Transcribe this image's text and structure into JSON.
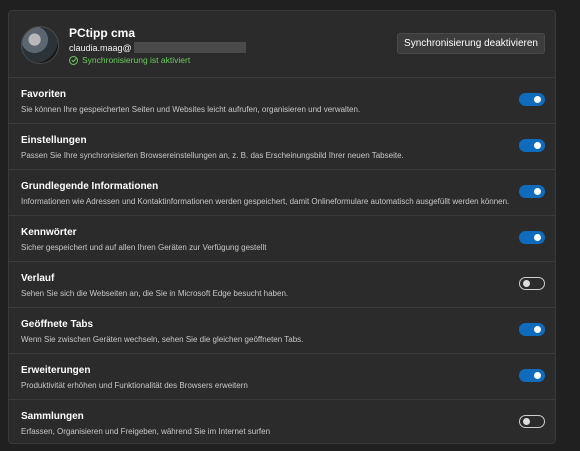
{
  "profile": {
    "name": "PCtipp cma",
    "email": "claudia.maag@",
    "sync_status": "Synchronisierung ist aktiviert"
  },
  "actions": {
    "disable_sync": "Synchronisierung deaktivieren"
  },
  "colors": {
    "accent": "#0f6cbd",
    "success": "#6ccb5f",
    "background": "#202020",
    "card": "#2b2b2b"
  },
  "rows": [
    {
      "title": "Favoriten",
      "desc": "Sie können Ihre gespeicherten Seiten und Websites leicht aufrufen, organisieren und verwalten.",
      "enabled": true
    },
    {
      "title": "Einstellungen",
      "desc": "Passen Sie Ihre synchronisierten Browsereinstellungen an, z. B. das Erscheinungsbild Ihrer neuen Tabseite.",
      "enabled": true
    },
    {
      "title": "Grundlegende Informationen",
      "desc": "Informationen wie Adressen und Kontaktinformationen werden gespeichert, damit Onlineformulare automatisch ausgefüllt werden können.",
      "enabled": true
    },
    {
      "title": "Kennwörter",
      "desc": "Sicher gespeichert und auf allen Ihren Geräten zur Verfügung gestellt",
      "enabled": true
    },
    {
      "title": "Verlauf",
      "desc": "Sehen Sie sich die Webseiten an, die Sie in Microsoft Edge besucht haben.",
      "enabled": false
    },
    {
      "title": "Geöffnete Tabs",
      "desc": "Wenn Sie zwischen Geräten wechseln, sehen Sie die gleichen geöffneten Tabs.",
      "enabled": true
    },
    {
      "title": "Erweiterungen",
      "desc": "Produktivität erhöhen und Funktionalität des Browsers erweitern",
      "enabled": true
    },
    {
      "title": "Sammlungen",
      "desc": "Erfassen, Organisieren und Freigeben, während Sie im Internet surfen",
      "enabled": false
    }
  ]
}
